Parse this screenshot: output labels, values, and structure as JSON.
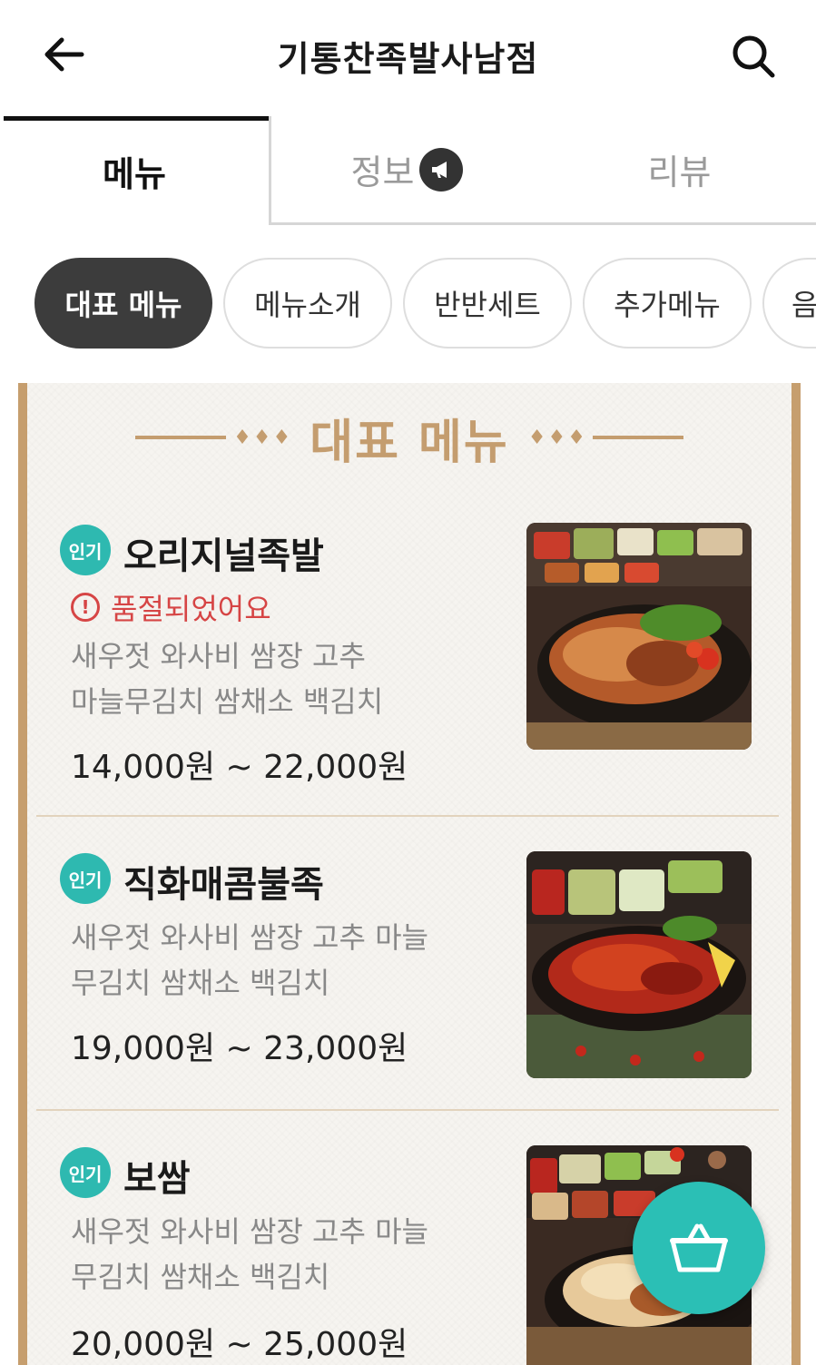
{
  "header": {
    "title": "기통찬족발사남점",
    "back_icon": "arrow-left-icon",
    "search_icon": "search-icon"
  },
  "tabs": [
    {
      "label": "메뉴",
      "active": true
    },
    {
      "label": "정보",
      "active": false,
      "icon": "megaphone-icon"
    },
    {
      "label": "리뷰",
      "active": false
    }
  ],
  "chips": [
    {
      "label": "대표 메뉴",
      "active": true
    },
    {
      "label": "메뉴소개",
      "active": false
    },
    {
      "label": "반반세트",
      "active": false
    },
    {
      "label": "추가메뉴",
      "active": false
    },
    {
      "label": "음",
      "active": false
    }
  ],
  "board": {
    "title": "대표 메뉴",
    "items": [
      {
        "badge": "인기",
        "name": "오리지널족발",
        "soldout": "품절되었어요",
        "desc_line1": "새우젓 와사비 쌈장 고추",
        "desc_line2": "마늘무김치 쌈채소  백김치",
        "price": "14,000원 ~ 22,000원"
      },
      {
        "badge": "인기",
        "name": "직화매콤불족",
        "desc_line1": "새우젓 와사비 쌈장 고추 마늘",
        "desc_line2": "무김치 쌈채소  백김치",
        "price": "19,000원 ~ 23,000원"
      },
      {
        "badge": "인기",
        "name": "보쌈",
        "desc_line1": "새우젓 와사비 쌈장 고추 마늘",
        "desc_line2": "무김치 쌈채소  백김치",
        "price": "20,000원 ~ 25,000원"
      }
    ]
  },
  "colors": {
    "accent_teal": "#2eb9b0",
    "board_gold": "#c49d6f",
    "soldout_red": "#d64545"
  },
  "cart_icon": "basket-icon"
}
